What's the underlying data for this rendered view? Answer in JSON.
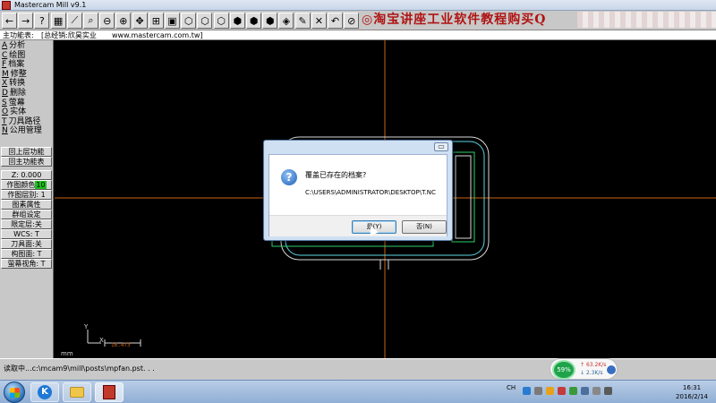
{
  "window": {
    "title": "Mastercam Mill v9.1"
  },
  "toolbar": {
    "buttons": [
      {
        "icon": "back-arrow-icon",
        "glyph": "←"
      },
      {
        "icon": "forward-arrow-icon",
        "glyph": "→"
      },
      {
        "icon": "help-icon",
        "glyph": "?"
      },
      {
        "icon": "calculator-icon",
        "glyph": "▦"
      },
      {
        "icon": "line-tool-icon",
        "glyph": "⟋"
      },
      {
        "icon": "zoom-window-icon",
        "glyph": "⌕"
      },
      {
        "icon": "zoom-out-icon",
        "glyph": "⊖"
      },
      {
        "icon": "zoom-in-icon",
        "glyph": "⊕"
      },
      {
        "icon": "pan-icon",
        "glyph": "✥"
      },
      {
        "icon": "fit-view-icon",
        "glyph": "⊞"
      },
      {
        "icon": "repaint-icon",
        "glyph": "▣"
      },
      {
        "icon": "top-view-icon",
        "glyph": "⬡"
      },
      {
        "icon": "front-view-icon",
        "glyph": "⬡"
      },
      {
        "icon": "side-view-icon",
        "glyph": "⬡"
      },
      {
        "icon": "iso-view-icon",
        "glyph": "⬢"
      },
      {
        "icon": "cube-view-icon",
        "glyph": "⬢"
      },
      {
        "icon": "shade-icon",
        "glyph": "⬢"
      },
      {
        "icon": "wireframe-icon",
        "glyph": "◈"
      },
      {
        "icon": "edit-pencil-icon",
        "glyph": "✎"
      },
      {
        "icon": "delete-icon",
        "glyph": "✕"
      },
      {
        "icon": "undo-icon",
        "glyph": "↶"
      },
      {
        "icon": "no-entry-icon",
        "glyph": "⊘"
      }
    ]
  },
  "watermark": {
    "text": "◎淘宝讲座工业软件教程购买Q"
  },
  "menu_header": {
    "label": "主功能表:",
    "dealer": "[总经销:欣昊实业",
    "url": "www.mastercam.com.tw]"
  },
  "main_menu": {
    "items": [
      {
        "key": "A",
        "label": "分析"
      },
      {
        "key": "C",
        "label": "绘图"
      },
      {
        "key": "F",
        "label": "档案"
      },
      {
        "key": "M",
        "label": "修整"
      },
      {
        "key": "X",
        "label": "转换"
      },
      {
        "key": "D",
        "label": "删除"
      },
      {
        "key": "S",
        "label": "萤幕"
      },
      {
        "key": "O",
        "label": "实体"
      },
      {
        "key": "T",
        "label": "刀具路径"
      },
      {
        "key": "N",
        "label": "公用管理"
      }
    ],
    "nav_buttons": [
      "回上层功能",
      "回主功能表"
    ]
  },
  "settings": {
    "z": "Z:  0.000",
    "color_label": "作图颜色",
    "color_value": "10",
    "level": "作图层别: 1",
    "attributes": "图素属性",
    "group": "群组设定",
    "limit": "限定层:关",
    "wcs": "WCS:  T",
    "tool_plane": "刀具面:关",
    "construction_plane": "构图面: T",
    "screen_view": "萤幕视角: T"
  },
  "canvas": {
    "axis_y": "Y",
    "axis_x": "X",
    "scale_value": "16.473",
    "mm_label": "mm"
  },
  "status": {
    "text": "读取中...c:\\mcam9\\mill\\posts\\mpfan.pst. . ."
  },
  "dialog": {
    "message": "覆盖已存在的档案?",
    "path": "C:\\USERS\\ADMINISTRATOR\\DESKTOP\\T.NC",
    "yes_label": "是(Y)",
    "no_label": "否(N)",
    "close_glyph": "▭"
  },
  "netwidget": {
    "percent": "59%",
    "upload": "63.2K/s",
    "download": "2.3K/s"
  },
  "taskbar": {
    "tray_lang": "CH",
    "time": "16:31",
    "date": "2016/2/14"
  },
  "colors": {
    "crosshair": "#c86414",
    "geometry_white": "#d8d8d8",
    "geometry_green": "#2ecf6a",
    "geometry_cyan": "#5dd6e6"
  }
}
